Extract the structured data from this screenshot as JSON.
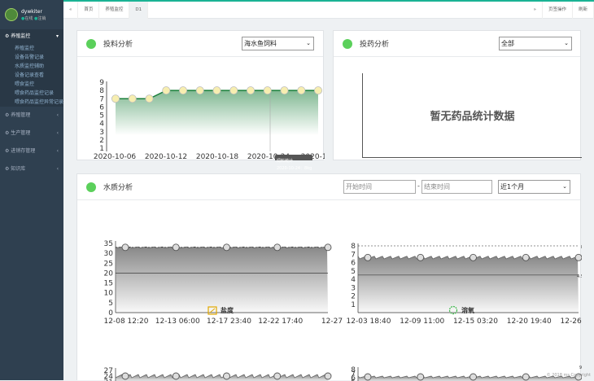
{
  "user": {
    "name": "dywkiter",
    "status": "在线",
    "logout": "注销"
  },
  "sidebar": {
    "groups": [
      {
        "label": "养殖监控",
        "active": true,
        "items": [
          "养殖监控",
          "设备告警记录",
          "水质监控辅助",
          "设备记录查看",
          "喂食监控",
          "喂食药品监控记录",
          "喂食药品监控异常记录"
        ]
      },
      {
        "label": "养殖管理"
      },
      {
        "label": "生产管理"
      },
      {
        "label": "进销存管理"
      },
      {
        "label": "知识库"
      }
    ]
  },
  "topbar": {
    "tabs": [
      "首页",
      "养殖监控",
      "D1"
    ],
    "right": [
      "页签操作",
      "刷新"
    ]
  },
  "feed_card": {
    "title": "投料分析",
    "select": "海水鱼饲料",
    "tooltip_title": "饲料统计",
    "tooltip_value": "2020-10-24：8kg"
  },
  "drug_card": {
    "title": "投药分析",
    "select": "全部",
    "empty": "暂无药品统计数据"
  },
  "water_card": {
    "title": "水质分析",
    "start_placeholder": "开始时间",
    "end_placeholder": "结束时间",
    "dash": "-",
    "range": "近1个月",
    "salinity_caption": "盐度",
    "oxygen_caption": "溶氧",
    "oxygen_max_label": "8",
    "oxygen_min_label": "4.5",
    "oxygen2_label": "9"
  },
  "footer": "© 2018 ms Copyright",
  "chart_data": [
    {
      "type": "line",
      "x": [
        "2020-10-06",
        "2020-10-08",
        "2020-10-10",
        "2020-10-12",
        "2020-10-14",
        "2020-10-16",
        "2020-10-18",
        "2020-10-20",
        "2020-10-22",
        "2020-10-24",
        "2020-10-26",
        "2020-10-28",
        "2020-10-30"
      ],
      "xticks": [
        "2020-10-06",
        "2020-10-12",
        "2020-10-18",
        "2020-10-24",
        "2020-10-3"
      ],
      "values": [
        7,
        7,
        7,
        8,
        8,
        8,
        8,
        8,
        8,
        8,
        8,
        8,
        8
      ],
      "ylim": [
        1,
        9
      ],
      "yticks": [
        1,
        2,
        3,
        4,
        5,
        6,
        7,
        8,
        9
      ],
      "color": "#1a7f3a"
    },
    {
      "type": "area",
      "xticks": [
        "12-08 12:20",
        "12-13 06:00",
        "12-17 23:40",
        "12-22 17:40",
        "12-27"
      ],
      "yticks": [
        0,
        5,
        10,
        15,
        20,
        25,
        30,
        35
      ],
      "ylim": [
        0,
        35
      ],
      "values": [
        33,
        33,
        33,
        33,
        33
      ],
      "min_line": 20,
      "max_line": 33
    },
    {
      "type": "area",
      "xticks": [
        "12-03 18:40",
        "12-09 11:00",
        "12-15 03:20",
        "12-20 19:40",
        "12-26 12:40"
      ],
      "yticks": [
        1,
        2,
        3,
        4,
        5,
        6,
        7,
        8
      ],
      "ylim": [
        0,
        8
      ],
      "values": [
        6.6,
        6.6,
        6.6,
        6.6,
        6.6
      ],
      "min_line": 4.5,
      "max_line": 8
    },
    {
      "type": "area",
      "yticks": [
        21,
        24,
        27
      ],
      "values": [
        24,
        24,
        24,
        24,
        24
      ]
    },
    {
      "type": "area",
      "yticks": [
        5,
        6,
        7,
        8
      ],
      "values": [
        6.2,
        6.2,
        6.2,
        6.2,
        6.2
      ]
    }
  ]
}
